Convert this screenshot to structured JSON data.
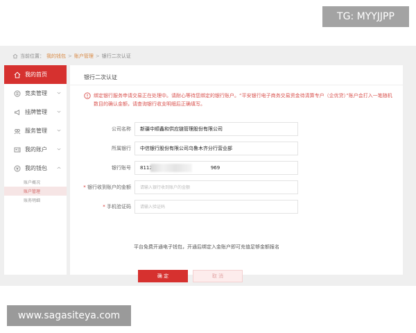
{
  "watermarks": {
    "top_right": "TG: MYYJJPP",
    "bottom_left": "www.sagasiteya.com"
  },
  "breadcrumb": {
    "prefix": "当前位置：",
    "items": [
      "我的钱包",
      "账户管理",
      "银行二次认证"
    ]
  },
  "sidebar": {
    "items": [
      {
        "label": "我的首页",
        "icon": "home-icon"
      },
      {
        "label": "竞卖管理",
        "icon": "gavel-icon"
      },
      {
        "label": "挂牌管理",
        "icon": "megaphone-icon"
      },
      {
        "label": "服务管理",
        "icon": "service-icon"
      },
      {
        "label": "我的账户",
        "icon": "user-card-icon"
      },
      {
        "label": "我的钱包",
        "icon": "wallet-icon"
      }
    ],
    "sub_items": [
      "账户概况",
      "账户管理",
      "账务明细"
    ]
  },
  "content": {
    "title": "银行二次认证",
    "notice": "绑定银行服务申请交易正在处理中。请耐心等待您绑定的银行账户。“平安银行电子商务交易资金待清算专户（企优贷）”账户会打入一笔随机数目的确认金额，请查询银行收支明细后正确填写。",
    "form": {
      "company_label": "公司名称",
      "company_value": "新疆中顺鑫和供应链管理股份有限公司",
      "bank_label": "所属银行",
      "bank_value": "中信银行股份有限公司乌鲁木齐分行营业部",
      "account_label": "银行账号",
      "account_prefix": "8112",
      "account_suffix": "969",
      "amount_required": "*",
      "amount_label": "银行收到账户的金额",
      "amount_placeholder": "请输入银行收到账户的金额",
      "sms_required": "*",
      "sms_label": "手机验证码",
      "sms_placeholder": "请输入验证码"
    },
    "free_note": "平台免费开通电子钱包，开通后绑定入金账户即可充值足够金额报名",
    "confirm_label": "确 定",
    "cancel_label": "取 消"
  },
  "colors": {
    "accent": "#d6312f",
    "link": "#d88a45",
    "notice": "#d9534f"
  }
}
